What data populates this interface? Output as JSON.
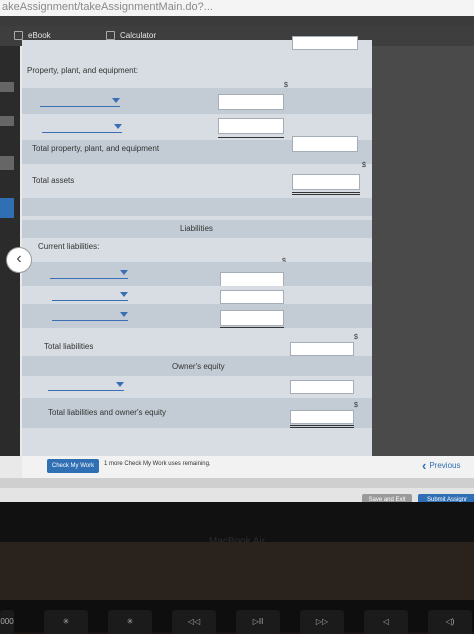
{
  "browser": {
    "url_text": "akeAssignment/takeAssignmentMain.do?..."
  },
  "tabs": [
    {
      "label": "eBook",
      "icon": "book-icon"
    },
    {
      "label": "Calculator",
      "icon": "calculator-icon"
    }
  ],
  "form": {
    "ppe_heading": "Property, plant, and equipment:",
    "total_ppe": "Total property, plant, and equipment",
    "total_assets": "Total assets",
    "liabilities_heading": "Liabilities",
    "current_liabilities": "Current liabilities:",
    "total_liabilities": "Total liabilities",
    "owners_equity": "Owner's equity",
    "total_liab_equity": "Total liabilities and owner's equity",
    "currency_symbol": "$"
  },
  "footer": {
    "check_button": "Check My Work",
    "remaining_text": "1 more Check My Work uses remaining.",
    "previous_button": "Previous"
  },
  "actions": {
    "save_exit": "Save and Exit",
    "submit": "Submit Assignr"
  },
  "laptop": {
    "brand": "MacBook Air"
  },
  "keyboard": {
    "keys": [
      "000",
      "✳",
      "✳",
      "◁◁",
      "▷II",
      "▷▷",
      "◁",
      "◁)"
    ]
  },
  "colors": {
    "accent": "#2f6fb3",
    "form_bg": "#d7dde2",
    "row_shade": "#c3ccd4"
  }
}
